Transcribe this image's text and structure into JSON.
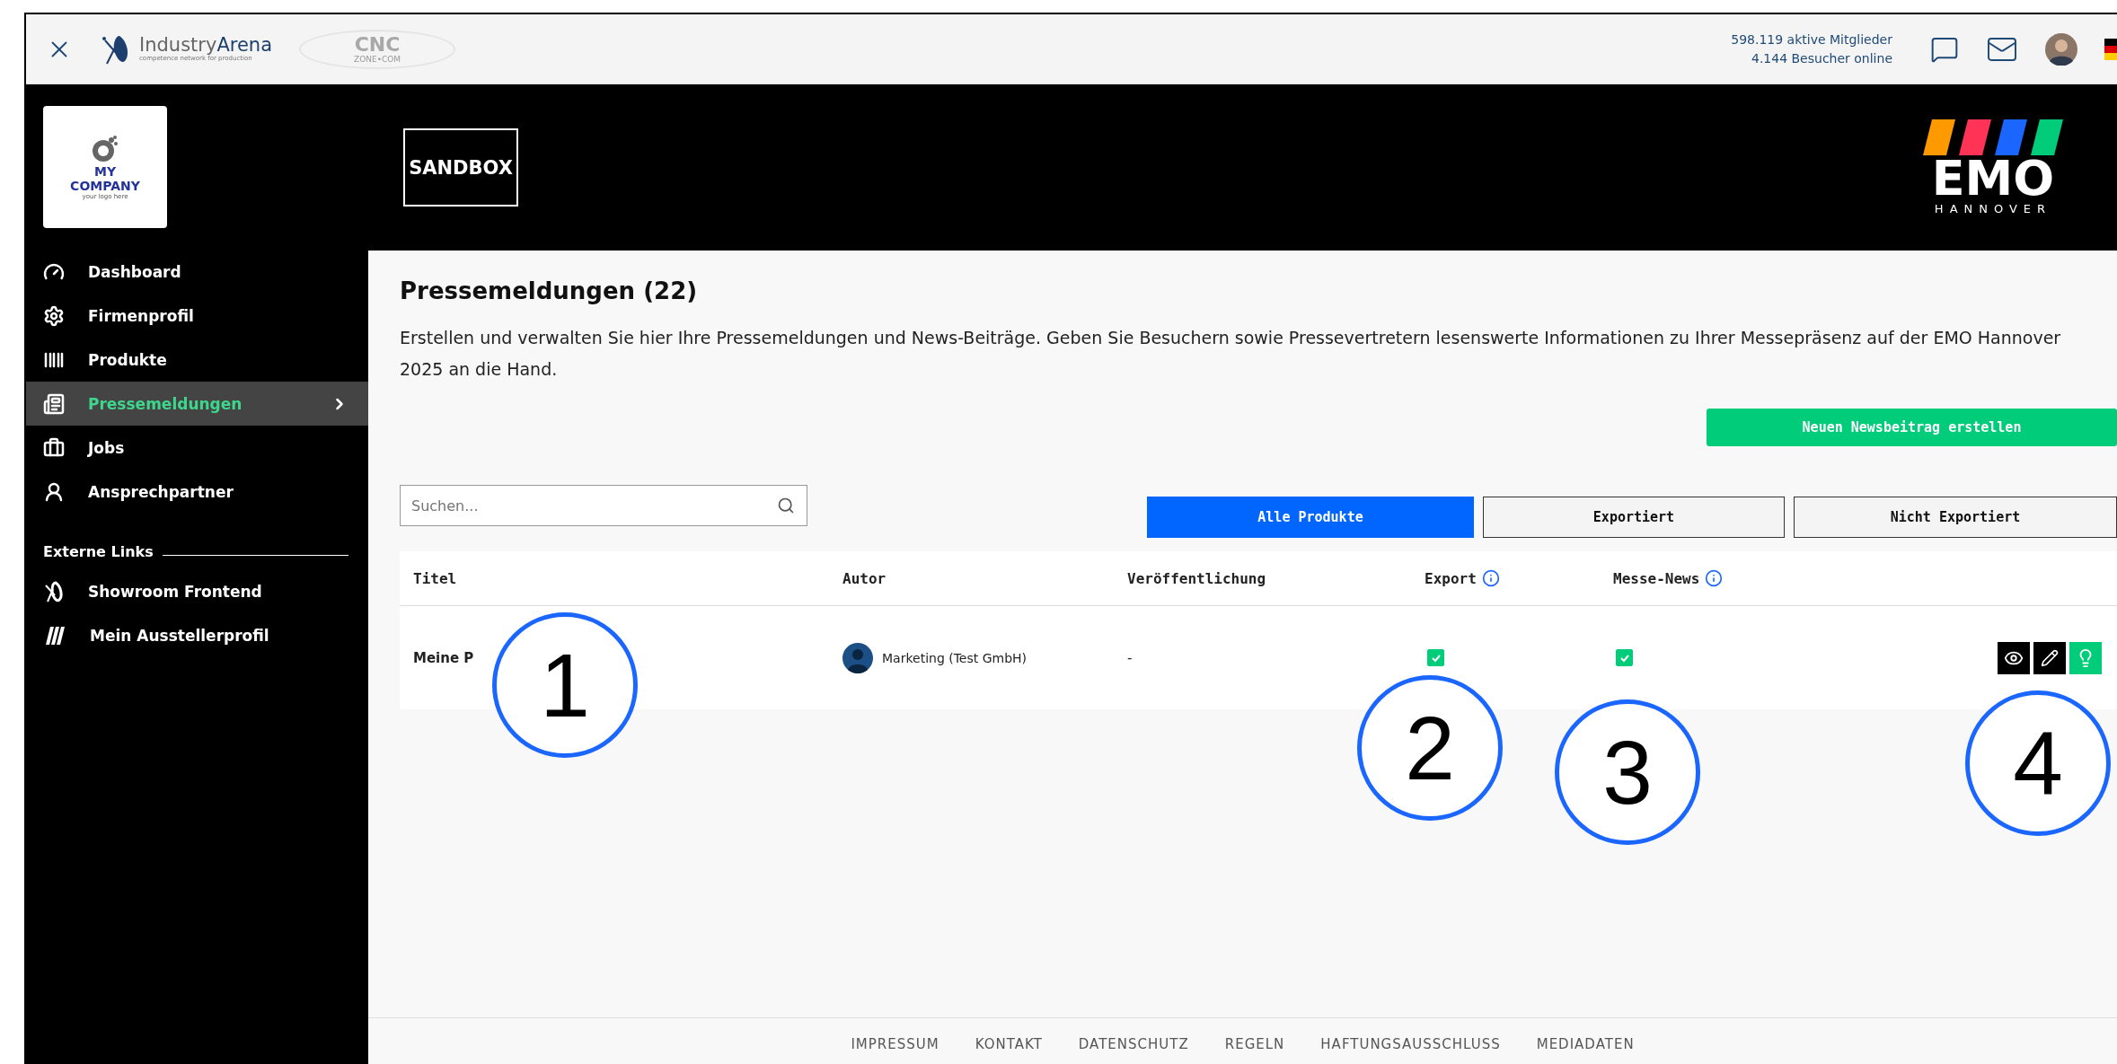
{
  "topbar": {
    "brand": "Industry**Arena**",
    "brand_tagline": "competence network for production",
    "partner_logo": {
      "text": "CNC",
      "subtext": "ZONE•COM"
    },
    "stats": [
      "598.119 aktive Mitglieder",
      "4.144 Besucher online"
    ]
  },
  "company_logo": {
    "lines": [
      "MY",
      "COMPANY"
    ],
    "tagline": "your logo here"
  },
  "header": {
    "badge": "SANDBOX",
    "event_logo": {
      "name": "EMO",
      "city": "HANNOVER"
    }
  },
  "sidebar": {
    "items": [
      {
        "label": "Dashboard",
        "selected": false
      },
      {
        "label": "Firmenprofil",
        "selected": false
      },
      {
        "label": "Produkte",
        "selected": false
      },
      {
        "label": "Pressemeldungen",
        "selected": true
      },
      {
        "label": "Jobs",
        "selected": false
      },
      {
        "label": "Ansprechpartner",
        "selected": false
      }
    ],
    "external_heading": "Externe Links",
    "external_links": [
      {
        "label": "Showroom Frontend"
      },
      {
        "label": "Mein Ausstellerprofil"
      }
    ]
  },
  "main": {
    "title": "Pressemeldungen (22)",
    "description": "Erstellen und verwalten Sie hier Ihre Pressemeldungen und News-Beiträge. Geben Sie Besuchern sowie Pressevertretern lesenswerte Informationen zu Ihrer Messepräsenz auf der EMO Hannover 2025 an die Hand.",
    "create_button": "Neuen Newsbeitrag erstellen",
    "search": {
      "placeholder": "Suchen..."
    },
    "filter_tabs": [
      {
        "label": "Alle Produkte",
        "selected": true
      },
      {
        "label": "Exportiert",
        "selected": false
      },
      {
        "label": "Nicht Exportiert",
        "selected": false
      }
    ],
    "table": {
      "columns": [
        {
          "label": "Titel",
          "info": false
        },
        {
          "label": "Autor",
          "info": false
        },
        {
          "label": "Veröffentlichung",
          "info": false
        },
        {
          "label": "Export",
          "info": true
        },
        {
          "label": "Messe-News",
          "info": true
        }
      ],
      "rows": [
        {
          "title": "Meine P",
          "author": "Marketing (Test GmbH)",
          "published": "-",
          "export": true,
          "messe_news": true
        }
      ]
    }
  },
  "annotations": [
    "1",
    "2",
    "3",
    "4"
  ],
  "footer": {
    "links": [
      "IMPRESSUM",
      "KONTAKT",
      "DATENSCHUTZ",
      "REGELN",
      "HAFTUNGSAUSSCHLUSS",
      "MEDIADATEN"
    ]
  }
}
